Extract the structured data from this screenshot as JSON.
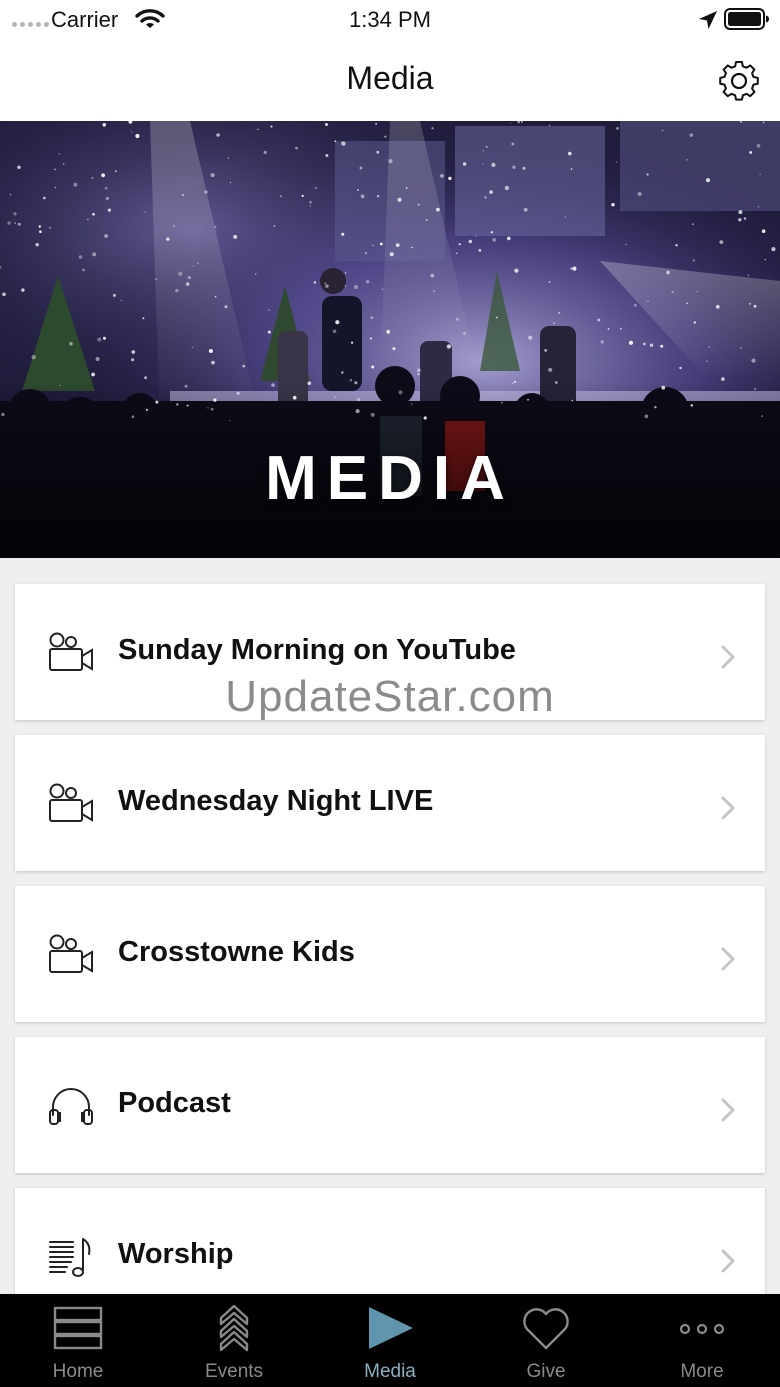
{
  "status_bar": {
    "carrier": "Carrier",
    "time": "1:34 PM"
  },
  "header": {
    "title": "Media",
    "settings_icon": "gear-icon"
  },
  "hero": {
    "title": "MEDIA"
  },
  "media_items": [
    {
      "label": "Sunday Morning on YouTube",
      "icon": "video-camera-icon"
    },
    {
      "label": "Wednesday Night LIVE",
      "icon": "video-camera-icon"
    },
    {
      "label": "Crosstowne Kids",
      "icon": "video-camera-icon"
    },
    {
      "label": "Podcast",
      "icon": "headphones-icon"
    },
    {
      "label": "Worship",
      "icon": "music-sheet-icon"
    }
  ],
  "watermark": "UpdateStar.com",
  "tab_bar": {
    "active_color": "#5f96ad",
    "tabs": [
      {
        "label": "Home",
        "icon": "stack-icon"
      },
      {
        "label": "Events",
        "icon": "chevrons-up-icon"
      },
      {
        "label": "Media",
        "icon": "play-icon"
      },
      {
        "label": "Give",
        "icon": "heart-icon"
      },
      {
        "label": "More",
        "icon": "more-dots-icon"
      }
    ],
    "active_tab": "Media"
  }
}
